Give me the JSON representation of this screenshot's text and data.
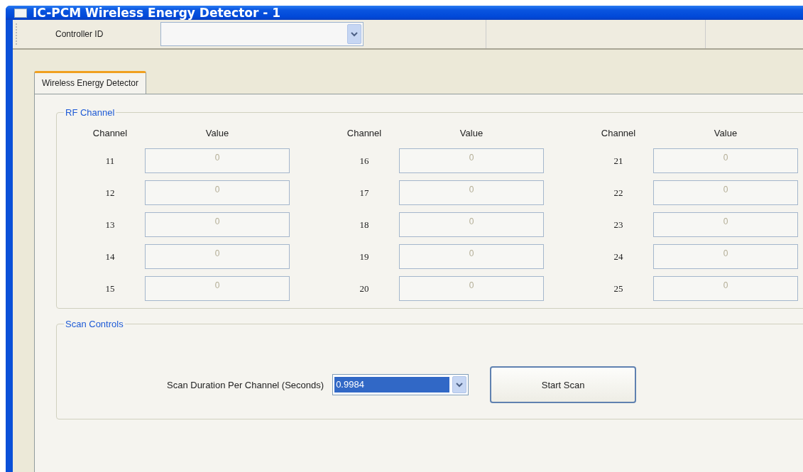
{
  "window": {
    "title": "IC-PCM Wireless Energy Detector - 1"
  },
  "toolbar": {
    "controller_label": "Controller ID"
  },
  "tabs": [
    {
      "label": "Wireless Energy Detector",
      "selected": true
    }
  ],
  "rf_channel": {
    "title": "RF Channel",
    "columns": [
      {
        "channel_header": "Channel",
        "value_header": "Value",
        "rows": [
          {
            "channel": "11",
            "value": "0",
            "disabled": true
          },
          {
            "channel": "12",
            "value": "0",
            "disabled": true
          },
          {
            "channel": "13",
            "value": "0",
            "disabled": true
          },
          {
            "channel": "14",
            "value": "0",
            "disabled": true
          },
          {
            "channel": "15",
            "value": "0",
            "disabled": true
          }
        ]
      },
      {
        "channel_header": "Channel",
        "value_header": "Value",
        "rows": [
          {
            "channel": "16",
            "value": "0",
            "disabled": true
          },
          {
            "channel": "17",
            "value": "0",
            "disabled": true
          },
          {
            "channel": "18",
            "value": "0",
            "disabled": true
          },
          {
            "channel": "19",
            "value": "0",
            "disabled": true
          },
          {
            "channel": "20",
            "value": "0",
            "disabled": true
          }
        ]
      },
      {
        "channel_header": "Channel",
        "value_header": "Value",
        "rows": [
          {
            "channel": "21",
            "value": "0",
            "disabled": true
          },
          {
            "channel": "22",
            "value": "0",
            "disabled": true
          },
          {
            "channel": "23",
            "value": "0",
            "disabled": true
          },
          {
            "channel": "24",
            "value": "0",
            "disabled": true
          },
          {
            "channel": "25",
            "value": "0",
            "disabled": true
          }
        ]
      }
    ]
  },
  "scan_controls": {
    "title": "Scan Controls",
    "duration_label": "Scan Duration Per Channel (Seconds)",
    "duration_value": "0.9984",
    "duration_highlighted": true,
    "start_button": "Start Scan"
  }
}
